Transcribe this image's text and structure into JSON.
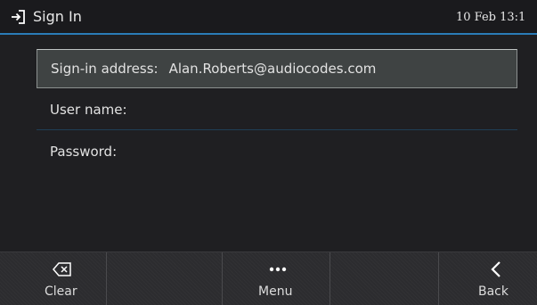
{
  "header": {
    "title": "Sign In",
    "title_icon": "sign-in-icon",
    "clock": "10 Feb 13:1",
    "accent_color": "#2a7bb7"
  },
  "form": {
    "sign_in_address": {
      "label": "Sign-in address:",
      "value": "Alan.Roberts@audiocodes.com"
    },
    "user_name": {
      "label": "User name:",
      "value": ""
    },
    "password": {
      "label": "Password:",
      "value": ""
    }
  },
  "softkeys": {
    "clear": {
      "label": "Clear",
      "icon": "backspace-icon"
    },
    "menu": {
      "label": "Menu",
      "icon": "ellipsis-icon"
    },
    "back": {
      "label": "Back",
      "icon": "chevron-left-icon"
    }
  }
}
